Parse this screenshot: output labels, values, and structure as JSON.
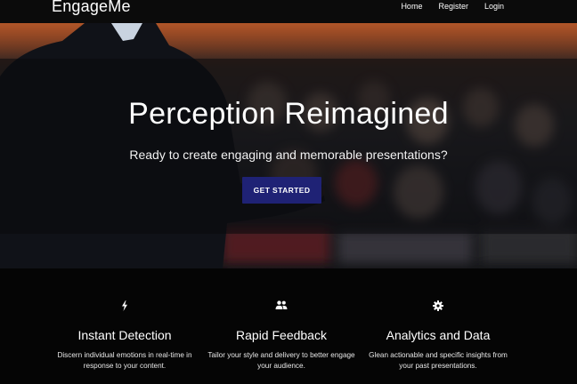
{
  "navbar": {
    "brand": "EngageMe",
    "links": [
      "Home",
      "Register",
      "Login"
    ]
  },
  "hero": {
    "title": "Perception Reimagined",
    "subtitle": "Ready to create engaging and memorable presentations?",
    "cta_label": "GET STARTED",
    "cta_color": "#1f2275"
  },
  "features": [
    {
      "icon": "lightning-icon",
      "title": "Instant Detection",
      "desc_line1": "Discern individual emotions in real-time in",
      "desc_line2": "response to your content."
    },
    {
      "icon": "people-icon",
      "title": "Rapid Feedback",
      "desc_line1": "Tailor your style and delivery to better engage",
      "desc_line2": "your audience."
    },
    {
      "icon": "gear-icon",
      "title": "Analytics and Data",
      "desc_line1": "Glean actionable and specific insights from",
      "desc_line2": "your past presentations."
    }
  ]
}
